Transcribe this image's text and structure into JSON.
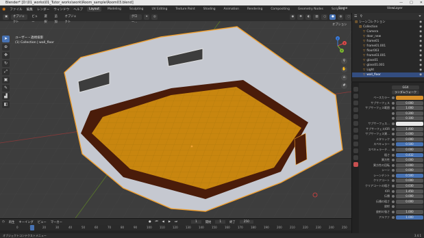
{
  "window": {
    "title": "Blender* [D:\\01_works\\01_Tutor_works\\work\\Room_sample\\Room03.blend]",
    "min": "—",
    "max": "□",
    "close": "✕"
  },
  "menu": [
    "ファイル",
    "編集",
    "レンダー",
    "ウィンドウ",
    "ヘルプ"
  ],
  "workspaces": [
    {
      "label": "Layout",
      "active": true
    },
    {
      "label": "Modeling"
    },
    {
      "label": "Sculpting"
    },
    {
      "label": "UV Editing"
    },
    {
      "label": "Texture Paint"
    },
    {
      "label": "Shading"
    },
    {
      "label": "Animation"
    },
    {
      "label": "Rendering"
    },
    {
      "label": "Compositing"
    },
    {
      "label": "Geometry Nodes"
    },
    {
      "label": "Scripting"
    }
  ],
  "scene": "Scene",
  "view_layer": "ViewLayer",
  "viewport": {
    "mode": "オブジェクト",
    "menus": [
      "ビュー",
      "選択",
      "追加",
      "オブジェクト"
    ],
    "transform": "グロー...",
    "options": "オプション",
    "info_line1": "ユーザー・透視投影",
    "info_line2": "(1) Collection | wall_floor",
    "gizmo": {
      "x": "X",
      "y": "Y",
      "z": "Z"
    }
  },
  "outliner": {
    "rows": [
      {
        "label": "シーンコレクション",
        "indent": 0
      },
      {
        "label": "Collection",
        "indent": 1
      },
      {
        "label": "Camera",
        "indent": 2
      },
      {
        "label": "door_new",
        "indent": 2
      },
      {
        "label": "frame01",
        "indent": 2
      },
      {
        "label": "frame01.001",
        "indent": 2
      },
      {
        "label": "floor003",
        "indent": 2
      },
      {
        "label": "frame03.001",
        "indent": 2
      },
      {
        "label": "glass01",
        "indent": 2
      },
      {
        "label": "glass01.001",
        "indent": 2
      },
      {
        "label": "Light",
        "indent": 2
      },
      {
        "label": "wall_floor",
        "indent": 2,
        "selected": true
      }
    ]
  },
  "properties": {
    "header": "GGX",
    "subheader": "ランダムウォーク",
    "rows": [
      {
        "label": "ベースカラー",
        "value": "",
        "kind": "color"
      },
      {
        "label": "サブサーフェス",
        "value": "0.000"
      },
      {
        "label": "サブサーフェス範囲",
        "value": "1.000"
      },
      {
        "label": "",
        "value": "0.200"
      },
      {
        "label": "",
        "value": "0.100"
      },
      {
        "label": "サブサーフェス...",
        "value": "",
        "kind": "white"
      },
      {
        "label": "サブサーフェスIOR",
        "value": "1.400"
      },
      {
        "label": "サブサーフェス異...",
        "value": "0.000"
      },
      {
        "label": "メタリック",
        "value": "0.000"
      },
      {
        "label": "スペキュラー",
        "value": "0.500",
        "kind": "blue"
      },
      {
        "label": "スペキュラーチ...",
        "value": "0.000"
      },
      {
        "label": "粗さ",
        "value": "0.432",
        "kind": "blue"
      },
      {
        "label": "異方性",
        "value": "0.000"
      },
      {
        "label": "異方性の回転",
        "value": "0.000"
      },
      {
        "label": "シーン",
        "value": "0.000"
      },
      {
        "label": "シーンチント",
        "value": "0.500",
        "kind": "blue"
      },
      {
        "label": "クリアコート",
        "value": "0.000"
      },
      {
        "label": "クリアコートの粗さ",
        "value": "0.030"
      },
      {
        "label": "IOR",
        "value": "1.450"
      },
      {
        "label": "伝播",
        "value": "0.000"
      },
      {
        "label": "伝播の粗さ",
        "value": "0.000"
      },
      {
        "label": "放射",
        "value": "",
        "kind": "dark"
      },
      {
        "label": "放射の強さ",
        "value": "1.000"
      },
      {
        "label": "アルファ",
        "value": "1.000",
        "kind": "blue"
      }
    ]
  },
  "timeline": {
    "menus": [
      "再生",
      "キーイング",
      "ビュー",
      "マーカー"
    ],
    "current_frame": "1",
    "start_label": "開始",
    "start": "1",
    "end_label": "終了",
    "end": "250",
    "ticks": [
      "0",
      "10",
      "20",
      "30",
      "40",
      "50",
      "60",
      "70",
      "80",
      "90",
      "100",
      "110",
      "120",
      "130",
      "140",
      "150",
      "160",
      "170",
      "180",
      "190",
      "200",
      "210",
      "220",
      "230",
      "240",
      "250"
    ]
  },
  "status": {
    "left": "オブジェクトコンテクストメニュー",
    "version": "3.4.1"
  }
}
